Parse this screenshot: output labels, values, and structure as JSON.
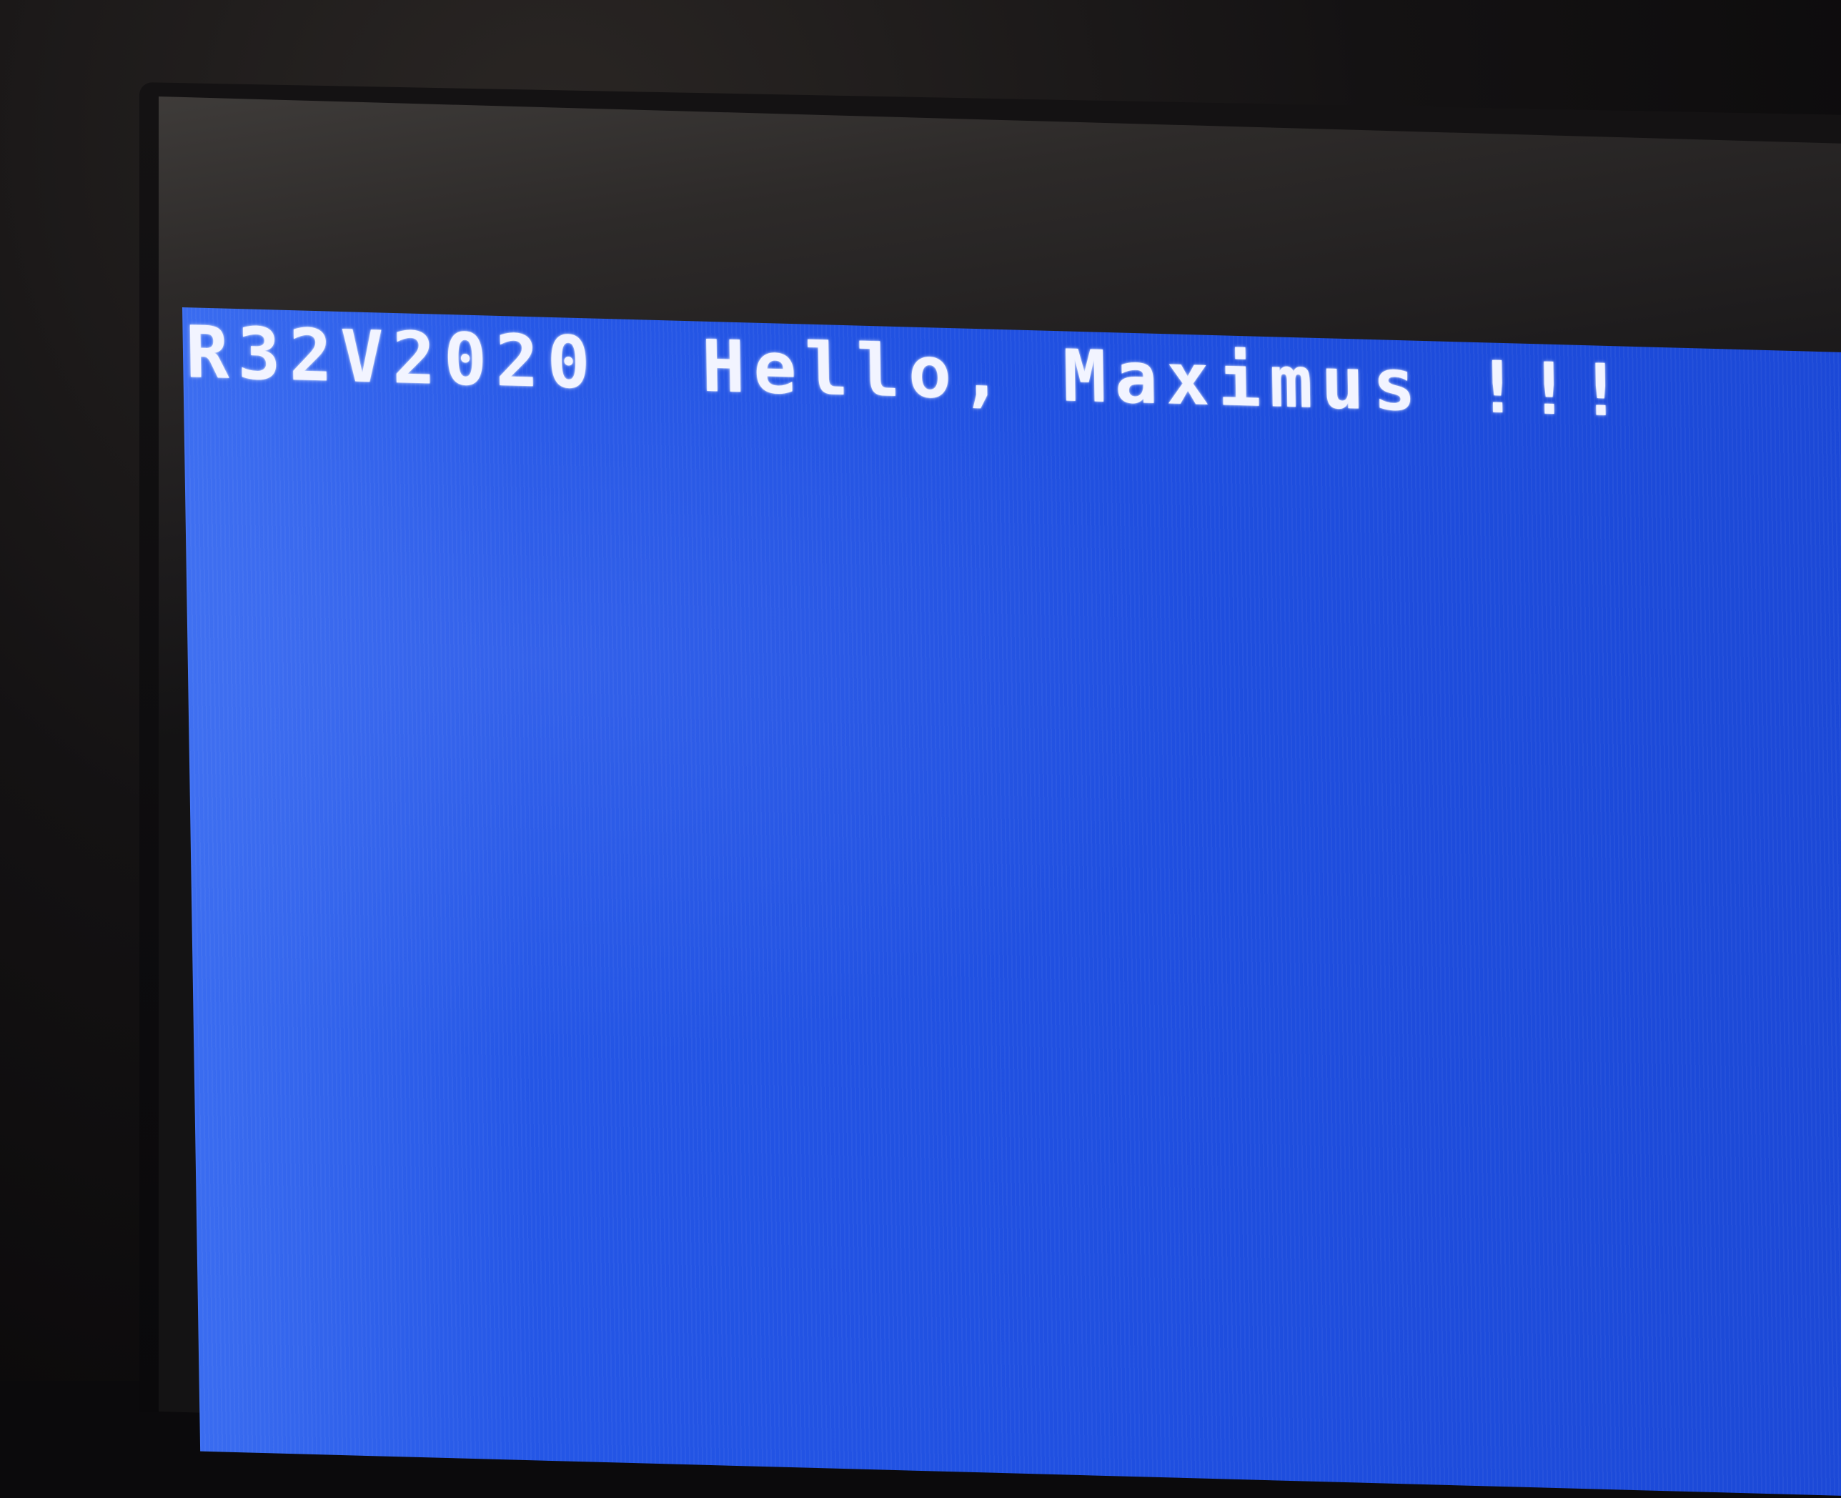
{
  "screen": {
    "line1": "R32V2020  Hello, Maximus !!!"
  },
  "colors": {
    "screen_background": "#1f4fe0",
    "text": "#f2f4ff",
    "bezel": "#0d0c0e"
  }
}
